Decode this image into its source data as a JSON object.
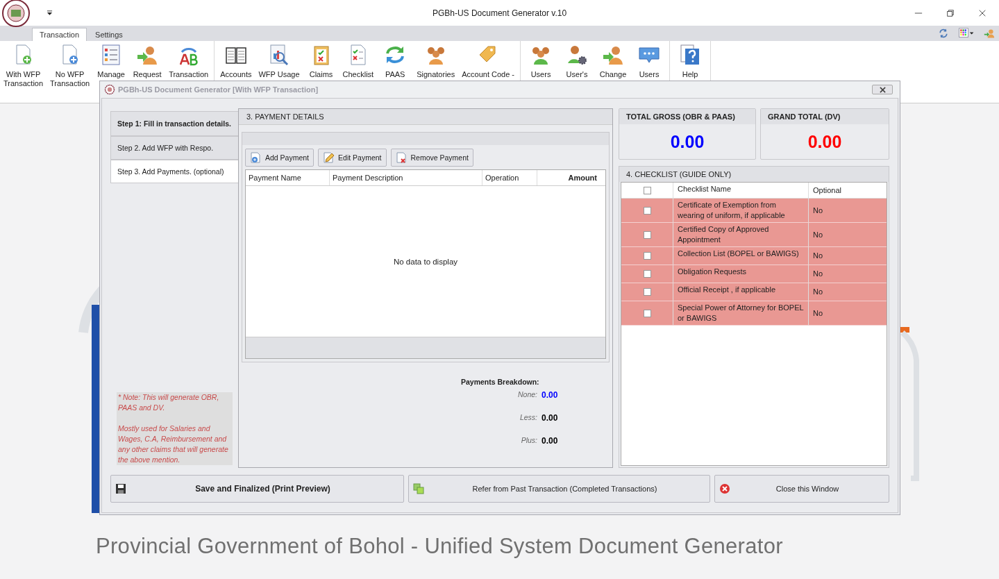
{
  "app": {
    "title": "PGBh-US Document Generator v.10"
  },
  "ribbon_tabs": [
    {
      "label": "Transaction",
      "selected": true
    },
    {
      "label": "Settings",
      "selected": false
    }
  ],
  "ribbon_groups": [
    [
      {
        "kind": "doc-add",
        "lines": [
          "With WFP",
          "Transaction"
        ]
      },
      {
        "kind": "doc-add-blue",
        "lines": [
          "No WFP",
          "Transaction"
        ]
      },
      {
        "kind": "list",
        "lines": [
          "Manage"
        ]
      },
      {
        "kind": "person-arrow",
        "lines": [
          "Request"
        ]
      },
      {
        "kind": "ab",
        "lines": [
          "Transaction"
        ]
      }
    ],
    [
      {
        "kind": "book",
        "lines": [
          "Accounts"
        ]
      },
      {
        "kind": "chart",
        "lines": [
          "WFP Usage"
        ]
      },
      {
        "kind": "clipboard",
        "lines": [
          "Claims"
        ]
      },
      {
        "kind": "checklist",
        "lines": [
          "Checklist"
        ]
      },
      {
        "kind": "cycle",
        "lines": [
          "PAAS"
        ]
      },
      {
        "kind": "people",
        "lines": [
          "Signatories"
        ]
      },
      {
        "kind": "tag",
        "lines": [
          "Account Code -"
        ]
      }
    ],
    [
      {
        "kind": "people-green",
        "lines": [
          "Users"
        ]
      },
      {
        "kind": "person-gear",
        "lines": [
          "User's"
        ]
      },
      {
        "kind": "person-refresh",
        "lines": [
          "Change"
        ]
      },
      {
        "kind": "chat",
        "lines": [
          "Users"
        ]
      }
    ],
    [
      {
        "kind": "help",
        "lines": [
          "Help"
        ]
      }
    ]
  ],
  "background_caption": "Provincial Government of Bohol - Unified System Document Generator",
  "dialog": {
    "title": "PGBh-US Document Generator [With WFP Transaction]",
    "steps": [
      {
        "label": "Step 1: Fill in transaction details.",
        "kind": "heading",
        "selected": false
      },
      {
        "label": "Step 2. Add WFP with Respo.",
        "kind": "step",
        "selected": false
      },
      {
        "label": "Step 3. Add Payments. (optional)",
        "kind": "step",
        "selected": true
      }
    ],
    "note": [
      "* Note: This will generate OBR, PAAS and DV.",
      "Mostly used for Salaries and Wages, C.A, Reimbursement and any other claims that will generate the above mention."
    ],
    "payment_details": {
      "title": "3. PAYMENT DETAILS",
      "buttons": [
        {
          "kind": "add",
          "label": "Add Payment"
        },
        {
          "kind": "edit",
          "label": "Edit Payment"
        },
        {
          "kind": "remove",
          "label": "Remove Payment"
        }
      ],
      "columns": [
        "Payment Name",
        "Payment Description",
        "Operation",
        "Amount"
      ],
      "empty_message": "No data to display",
      "breakdown_title": "Payments Breakdown:",
      "breakdown": [
        {
          "label": "None:",
          "value": "0.00",
          "color": "#0000ff"
        },
        {
          "label": "Less:",
          "value": "0.00",
          "color": "#000000"
        },
        {
          "label": "Plus:",
          "value": "0.00",
          "color": "#000000"
        }
      ]
    },
    "totals": [
      {
        "label": "TOTAL GROSS (OBR & PAAS)",
        "value": "0.00",
        "color": "#0000ff"
      },
      {
        "label": "GRAND TOTAL (DV)",
        "value": "0.00",
        "color": "#ff0000"
      }
    ],
    "checklist": {
      "title": "4. CHECKLIST (GUIDE ONLY)",
      "all_checked": false,
      "columns": [
        "Checklist Name",
        "Optional"
      ],
      "rows": [
        {
          "name": "Certificate of Exemption from wearing of uniform, if applicable",
          "optional": "No",
          "checked": false
        },
        {
          "name": "Certified Copy of Approved Appointment",
          "optional": "No",
          "checked": false
        },
        {
          "name": "Collection List (BOPEL or BAWIGS)",
          "optional": "No",
          "checked": false
        },
        {
          "name": "Obligation Requests",
          "optional": "No",
          "checked": false
        },
        {
          "name": "Official Receipt , if applicable",
          "optional": "No",
          "checked": false
        },
        {
          "name": "Special Power of Attorney for BOPEL or BAWIGS",
          "optional": "No",
          "checked": false
        }
      ]
    },
    "actions": [
      {
        "kind": "save",
        "label": "Save and Finalized (Print Preview)"
      },
      {
        "kind": "refer",
        "label": "Refer from Past Transaction (Completed Transactions)"
      },
      {
        "kind": "close",
        "label": "Close this Window"
      }
    ]
  }
}
